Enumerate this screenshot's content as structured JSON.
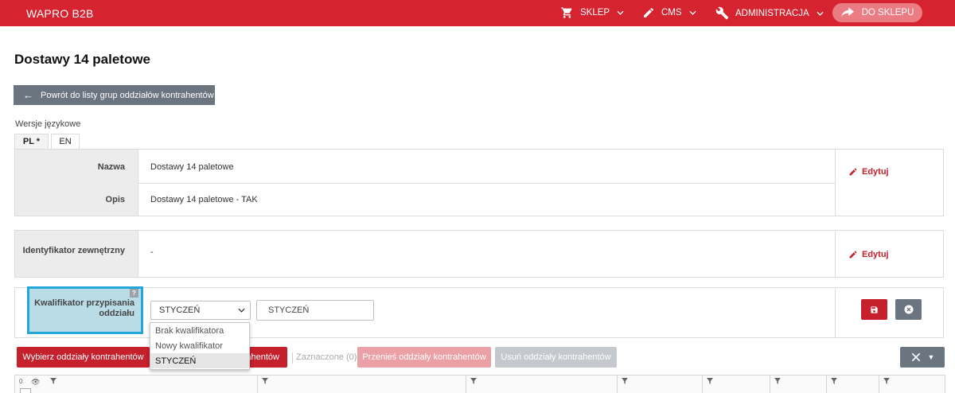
{
  "topbar": {
    "brand": "WAPRO B2B",
    "nav": [
      {
        "label": "SKLEP",
        "icon": "cart-icon"
      },
      {
        "label": "CMS",
        "icon": "pencil-icon"
      },
      {
        "label": "ADMINISTRACJA",
        "icon": "wrench-icon"
      }
    ],
    "shop_button": "DO SKLEPU",
    "brand_color": "#d5232f"
  },
  "page": {
    "title": "Dostawy 14 paletowe",
    "back_button": "Powrót do listy grup oddziałów kontrahentów"
  },
  "languages": {
    "label": "Wersje językowe",
    "tabs": [
      "PL *",
      "EN"
    ],
    "active": "PL *"
  },
  "details": {
    "name_label": "Nazwa",
    "name_value": "Dostawy 14 paletowe",
    "desc_label": "Opis",
    "desc_value": "Dostawy 14 paletowe - TAK",
    "edit_label": "Edytuj",
    "ext_id_label": "Identyfikator zewnętrzny",
    "ext_id_value": "-",
    "edit_label_2": "Edytuj"
  },
  "qualifier": {
    "label": "Kwalifikator przypisania oddziału",
    "help": "?",
    "selected": "STYCZEŃ",
    "text_value": "STYCZEŃ",
    "options": [
      "Brak kwalifikatora",
      "Nowy kwalifikator",
      "STYCZEŃ"
    ]
  },
  "actions": {
    "pick": "Wybierz oddziały kontrahentów",
    "hidden_btn": "ahentów",
    "marked": "Zaznaczone (0)",
    "move": "Przenieś oddziały kontrahentów",
    "delete": "Usuń oddziały kontrahentów"
  },
  "grid": {
    "count": "0"
  }
}
